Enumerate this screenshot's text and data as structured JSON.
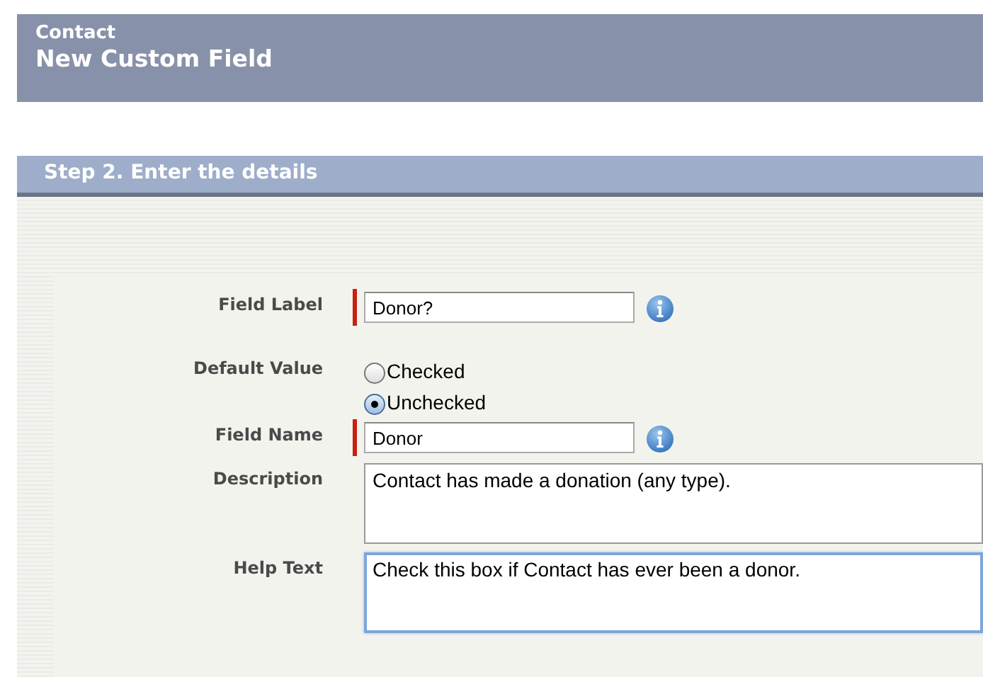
{
  "header": {
    "object": "Contact",
    "title": "New Custom Field"
  },
  "section": {
    "title": "Step 2. Enter the details"
  },
  "fields": [
    {
      "kind": "text",
      "label": "Field Label",
      "value": "Donor?",
      "required": true,
      "info": true
    },
    {
      "kind": "radio",
      "label": "Default Value",
      "options": [
        {
          "label": "Checked",
          "selected": false
        },
        {
          "label": "Unchecked",
          "selected": true
        }
      ]
    },
    {
      "kind": "text",
      "label": "Field Name",
      "value": "Donor",
      "required": true,
      "info": true
    },
    {
      "kind": "textarea",
      "label": "Description",
      "value": "Contact has made a donation (any type).",
      "focused": false
    },
    {
      "kind": "textarea",
      "label": "Help Text",
      "value": "Check this box if Contact has ever been a donor.",
      "focused": true
    }
  ]
}
